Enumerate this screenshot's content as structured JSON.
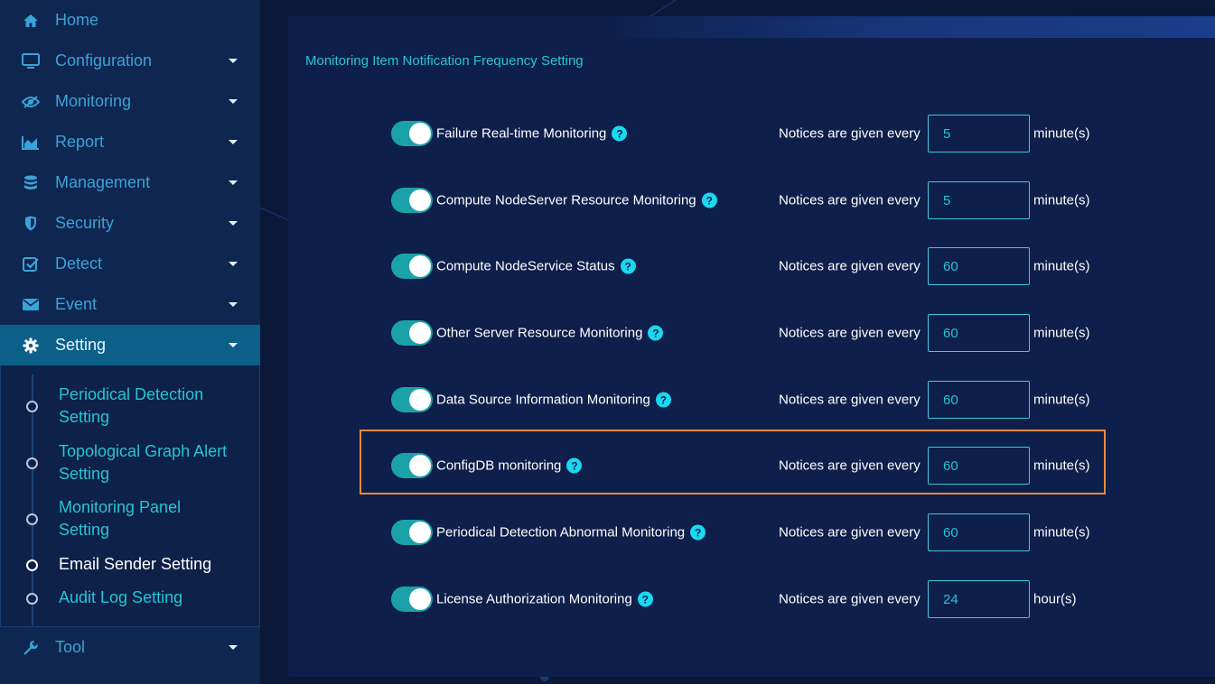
{
  "sidebar": {
    "items": [
      {
        "label": "Home",
        "icon": "home-icon",
        "has_caret": false
      },
      {
        "label": "Configuration",
        "icon": "monitor-icon",
        "has_caret": true
      },
      {
        "label": "Monitoring",
        "icon": "eye-icon",
        "has_caret": true
      },
      {
        "label": "Report",
        "icon": "area-chart-icon",
        "has_caret": true
      },
      {
        "label": "Management",
        "icon": "database-icon",
        "has_caret": true
      },
      {
        "label": "Security",
        "icon": "shield-icon",
        "has_caret": true
      },
      {
        "label": "Detect",
        "icon": "check-square-icon",
        "has_caret": true
      },
      {
        "label": "Event",
        "icon": "envelope-icon",
        "has_caret": true
      },
      {
        "label": "Setting",
        "icon": "gear-icon",
        "has_caret": true,
        "active": true
      }
    ],
    "submenu": [
      {
        "line1": "Periodical Detection",
        "line2": "Setting"
      },
      {
        "line1": "Topological Graph Alert",
        "line2": "Setting"
      },
      {
        "line1": "Monitoring Panel",
        "line2": "Setting"
      },
      {
        "line1": "Email Sender Setting",
        "line2": "",
        "current": true
      },
      {
        "line1": "Audit Log Setting",
        "line2": ""
      }
    ],
    "tool": {
      "label": "Tool",
      "icon": "wrench-icon"
    }
  },
  "main": {
    "section_title": "Monitoring Item Notification Frequency Setting",
    "notice_text": "Notices are given every",
    "help_symbol": "?",
    "rows": [
      {
        "label": "Failure Real-time Monitoring",
        "enabled": true,
        "value": "5",
        "unit": "minute(s)"
      },
      {
        "label": "Compute NodeServer Resource Monitoring",
        "enabled": true,
        "value": "5",
        "unit": "minute(s)"
      },
      {
        "label": "Compute NodeService Status",
        "enabled": true,
        "value": "60",
        "unit": "minute(s)"
      },
      {
        "label": "Other Server Resource Monitoring",
        "enabled": true,
        "value": "60",
        "unit": "minute(s)"
      },
      {
        "label": "Data Source Information Monitoring",
        "enabled": true,
        "value": "60",
        "unit": "minute(s)"
      },
      {
        "label": "ConfigDB monitoring",
        "enabled": true,
        "value": "60",
        "unit": "minute(s)",
        "highlighted": true
      },
      {
        "label": "Periodical Detection Abnormal Monitoring",
        "enabled": true,
        "value": "60",
        "unit": "minute(s)"
      },
      {
        "label": "License Authorization Monitoring",
        "enabled": true,
        "value": "24",
        "unit": "hour(s)"
      }
    ]
  },
  "colors": {
    "accent": "#27c4d6",
    "toggle_on": "#1aa2a8",
    "highlight": "#e88a3a",
    "active_nav": "#0b5f89"
  }
}
